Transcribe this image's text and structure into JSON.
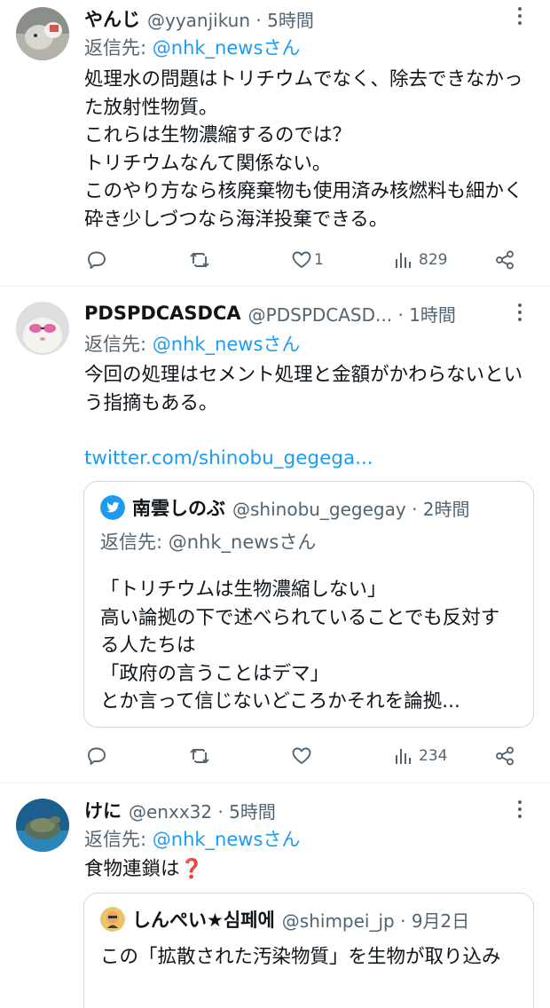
{
  "tweets": [
    {
      "display_name": "やんじ",
      "handle_time": "@yyanjikun · 5時間",
      "reply_prefix": "返信先: ",
      "reply_mention": "@nhk_newsさん",
      "text": "処理水の問題はトリチウムでなく、除去できなかった放射性物質。\nこれらは生物濃縮するのでは？\nトリチウムなんて関係ない。\nこのやり方なら核廃棄物も使用済み核燃料も細かく砕き少しづつなら海洋投棄できる。",
      "actions": {
        "reply_icon": "reply-icon",
        "retweet_icon": "retweet-icon",
        "likes": "1",
        "views": "829",
        "share_icon": "share-icon"
      }
    },
    {
      "display_name": "PDSPDCASDCA",
      "handle_time": "@PDSPDCASD... · 1時間",
      "reply_prefix": "返信先: ",
      "reply_mention": "@nhk_newsさん",
      "text": "今回の処理はセメント処理と金額がかわらないという指摘もある。",
      "link": "twitter.com/shinobu_gegega...",
      "quote": {
        "display_name": "南雲しのぶ",
        "handle_time": "@shinobu_gegegay · 2時間",
        "reply_line": "返信先: @nhk_newsさん",
        "text": "「トリチウムは生物濃縮しない」\n高い論拠の下で述べられていることでも反対する人たちは\n「政府の言うことはデマ」\nとか言って信じないどころかそれを論拠..."
      },
      "actions": {
        "likes": "",
        "views": "234"
      }
    },
    {
      "display_name": "けに",
      "handle_time": "@enxx32 · 5時間",
      "reply_prefix": "返信先: ",
      "reply_mention": "@nhk_newsさん",
      "text": "食物連鎖は❓",
      "quote": {
        "display_name": "しんぺい★심페에",
        "handle_time": "@shimpei_jp · 9月2日",
        "text": "この「拡散された汚染物質」を生物が取り込み"
      }
    }
  ],
  "colors": {
    "accent": "#1d9bf0",
    "secondary": "#536471",
    "text": "#0f1419",
    "divider": "#eff3f4",
    "quote_border": "#cfd9de"
  }
}
